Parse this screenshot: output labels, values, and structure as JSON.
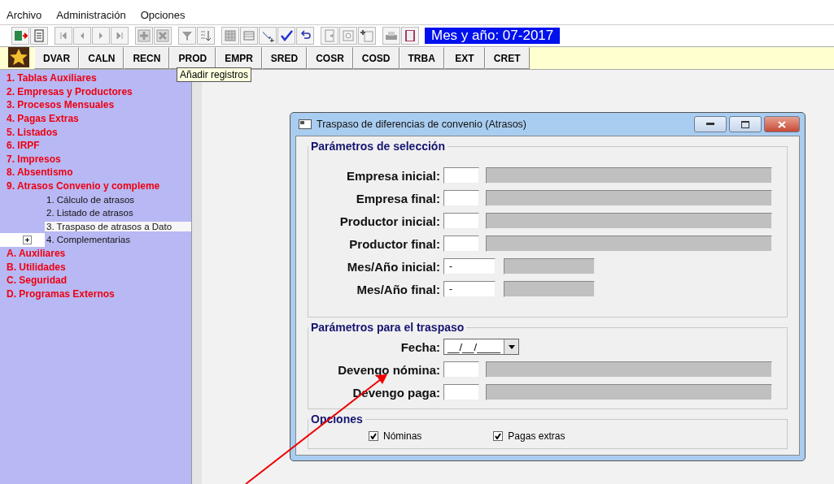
{
  "menu": [
    {
      "label": "Archivo"
    },
    {
      "label": "Administración"
    },
    {
      "label": "Opciones"
    }
  ],
  "toolbar": {
    "period": "Mes y año: 07-2017"
  },
  "shortcuts": [
    "DVAR",
    "CALN",
    "RECN",
    "PROD",
    "EMPR",
    "SRED",
    "COSR",
    "COSD",
    "TRBA",
    "EXT",
    "CRET"
  ],
  "tooltip": "Añadir registros",
  "sidebar": {
    "items": [
      {
        "label": "1. Tablas Auxiliares",
        "selected": false
      },
      {
        "label": "2. Empresas y Productores",
        "selected": false
      },
      {
        "label": "3. Procesos Mensuales",
        "selected": false
      },
      {
        "label": "4. Pagas Extras",
        "selected": false
      },
      {
        "label": "5. Listados",
        "selected": false
      },
      {
        "label": "6. IRPF",
        "selected": false
      },
      {
        "label": "7. Impresos",
        "selected": false
      },
      {
        "label": "8. Absentismo",
        "selected": false
      },
      {
        "label": "9. Atrasos Convenio y compleme",
        "selected": false,
        "children": [
          {
            "label": "1. Cálculo de atrasos",
            "selected": false
          },
          {
            "label": "2. Listado de atrasos",
            "selected": false
          },
          {
            "label": "3. Traspaso de atrasos a Dato",
            "selected": true
          },
          {
            "label": "4. Complementarias",
            "selected": false,
            "expanded": false
          }
        ]
      },
      {
        "label": "A. Auxiliares",
        "selected": false
      },
      {
        "label": "B. Utilidades",
        "selected": false
      },
      {
        "label": "C. Seguridad",
        "selected": false
      },
      {
        "label": "D. Programas Externos",
        "selected": false
      }
    ]
  },
  "dialog": {
    "title": "Traspaso de diferencias de convenio (Atrasos)",
    "groups": [
      {
        "legend": "Parámetros de selección",
        "fields": [
          {
            "kind": "lookup",
            "label": "Empresa inicial:"
          },
          {
            "kind": "lookup",
            "label": "Empresa final:"
          },
          {
            "kind": "lookup",
            "label": "Productor inicial:"
          },
          {
            "kind": "lookup",
            "label": "Productor final:"
          },
          {
            "kind": "period",
            "label": "Mes/Año inicial:",
            "value": "-"
          },
          {
            "kind": "period",
            "label": "Mes/Año final:",
            "value": "-"
          }
        ]
      },
      {
        "legend": "Parámetros para el traspaso",
        "fields": [
          {
            "kind": "date",
            "label": "Fecha:",
            "value": "__/__/____"
          },
          {
            "kind": "lookup",
            "label": "Devengo nómina:"
          },
          {
            "kind": "lookup",
            "label": "Devengo paga:"
          }
        ]
      },
      {
        "legend": "Opciones",
        "checkboxes": [
          {
            "label": "Nóminas",
            "checked": true
          },
          {
            "label": "Pagas extras",
            "checked": true
          }
        ]
      }
    ]
  }
}
